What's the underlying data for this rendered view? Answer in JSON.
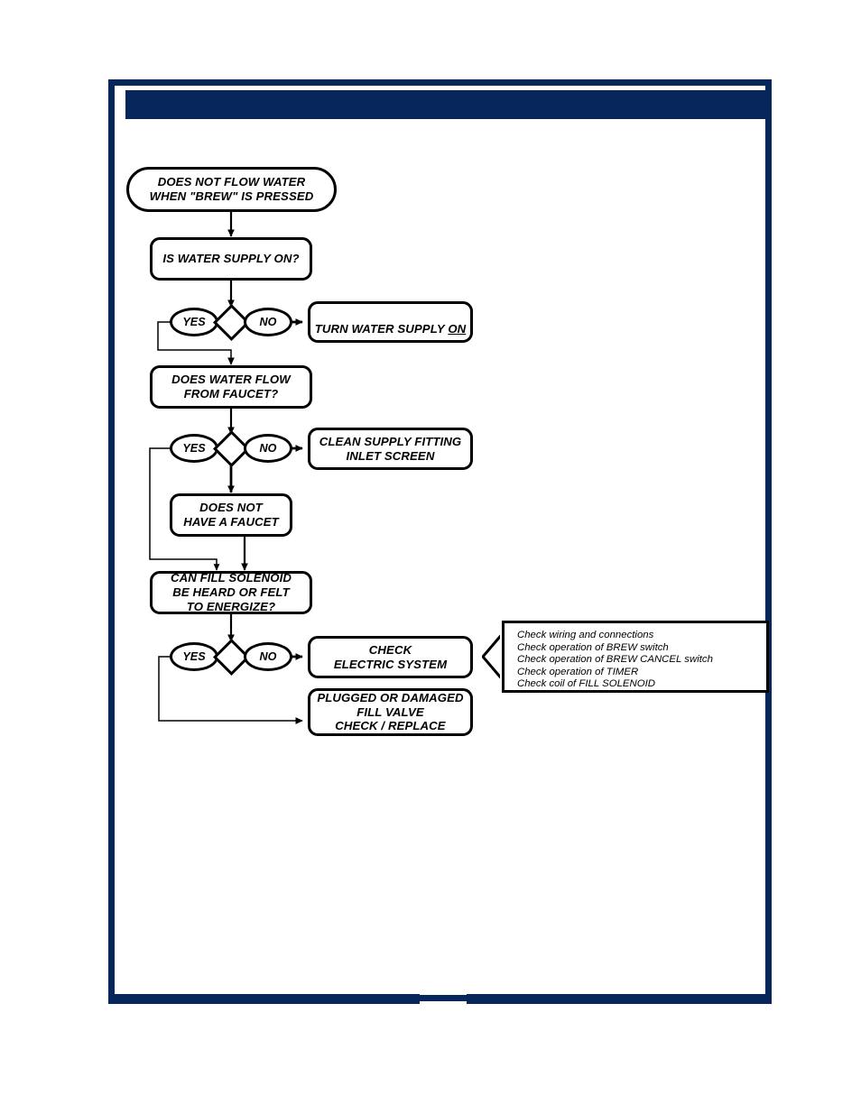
{
  "page": {
    "header_title": "",
    "footer_page_number": "",
    "accent_color": "#06265c",
    "line_color": "#000000",
    "background_color": "#ffffff"
  },
  "chart_data": {
    "type": "diagram",
    "title": "Troubleshooting flowchart: does not flow water when BREW is pressed",
    "nodes": [
      {
        "id": "start",
        "shape": "stadium",
        "text": "DOES NOT FLOW WATER\nWHEN \"BREW\" IS PRESSED"
      },
      {
        "id": "water-supply",
        "shape": "rounded",
        "text": "IS WATER SUPPLY ON?"
      },
      {
        "id": "turn-on",
        "shape": "rounded",
        "text": "TURN WATER SUPPLY ON",
        "underline_word": "ON"
      },
      {
        "id": "faucet-flow",
        "shape": "rounded",
        "text": "DOES WATER FLOW\nFROM FAUCET?"
      },
      {
        "id": "clean-screen",
        "shape": "rounded",
        "text": "CLEAN SUPPLY FITTING\nINLET SCREEN"
      },
      {
        "id": "no-faucet",
        "shape": "rounded",
        "text": "DOES NOT\nHAVE A FAUCET"
      },
      {
        "id": "fill-solenoid",
        "shape": "rounded",
        "text": "CAN FILL SOLENOID\nBE HEARD OR FELT\nTO ENERGIZE?"
      },
      {
        "id": "check-electric",
        "shape": "rounded",
        "text": "CHECK\nELECTRIC SYSTEM"
      },
      {
        "id": "fill-valve",
        "shape": "rounded",
        "text": "PLUGGED OR DAMAGED\nFILL VALVE\nCHECK / REPLACE"
      }
    ],
    "decisions": [
      {
        "id": "decision-supply",
        "yes_label": "YES",
        "no_label": "NO",
        "yes_target": "faucet-flow",
        "no_target": "turn-on"
      },
      {
        "id": "decision-faucet",
        "yes_label": "YES",
        "no_label": "NO",
        "yes_target": "fill-solenoid",
        "no_target": "clean-screen"
      },
      {
        "id": "decision-solenoid",
        "yes_label": "YES",
        "no_label": "NO",
        "yes_target": "fill-valve",
        "no_target": "check-electric"
      }
    ],
    "callout": {
      "attached_to": "check-electric",
      "lines": [
        "Check wiring and connections",
        "Check operation of BREW switch",
        "Check operation of BREW CANCEL switch",
        "Check operation of TIMER",
        "Check coil of FILL SOLENOID"
      ]
    }
  }
}
